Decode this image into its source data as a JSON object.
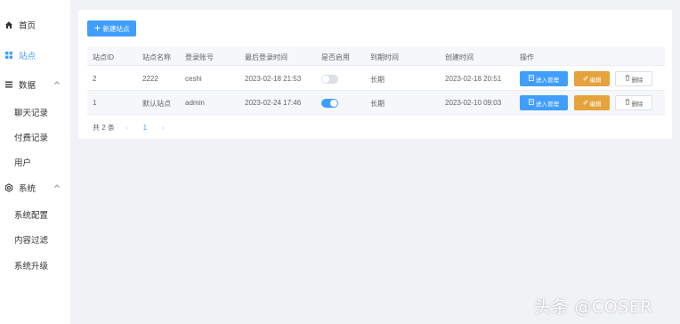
{
  "sidebar": {
    "items": [
      {
        "label": "首页",
        "icon": "home-icon",
        "active": false
      },
      {
        "label": "站点",
        "icon": "grid-icon",
        "active": true
      },
      {
        "label": "数据",
        "icon": "list-icon",
        "active": false,
        "expanded": true
      },
      {
        "label": "系统",
        "icon": "gear-icon",
        "active": false,
        "expanded": true
      }
    ],
    "data_children": [
      "聊天记录",
      "付费记录",
      "用户"
    ],
    "system_children": [
      "系统配置",
      "内容过滤",
      "系统升级"
    ]
  },
  "toolbar": {
    "new_button": "新建站点",
    "new_icon": "plus-icon"
  },
  "table": {
    "columns": [
      "站点ID",
      "站点名称",
      "登录账号",
      "最后登录时间",
      "是否启用",
      "到期时间",
      "创建时间",
      "操作"
    ],
    "rows": [
      {
        "id": "2",
        "name": "2222",
        "account": "ceshi",
        "last_login": "2023-02-18 21:53",
        "enabled": false,
        "expiry": "长期",
        "created": "2023-02-18 20:51"
      },
      {
        "id": "1",
        "name": "默认站点",
        "account": "admin",
        "last_login": "2023-02-24 17:46",
        "enabled": true,
        "expiry": "长期",
        "created": "2023-02-10 09:03"
      }
    ],
    "actions": {
      "enter": "进入管理",
      "edit": "编辑",
      "delete": "删除"
    }
  },
  "pagination": {
    "total_text": "共 2 条",
    "prev": "‹",
    "page": "1",
    "next": "›"
  },
  "watermark": "头条 @COSER",
  "colors": {
    "primary": "#409eff",
    "warning": "#e6a23c",
    "background": "#f0f2f5"
  }
}
